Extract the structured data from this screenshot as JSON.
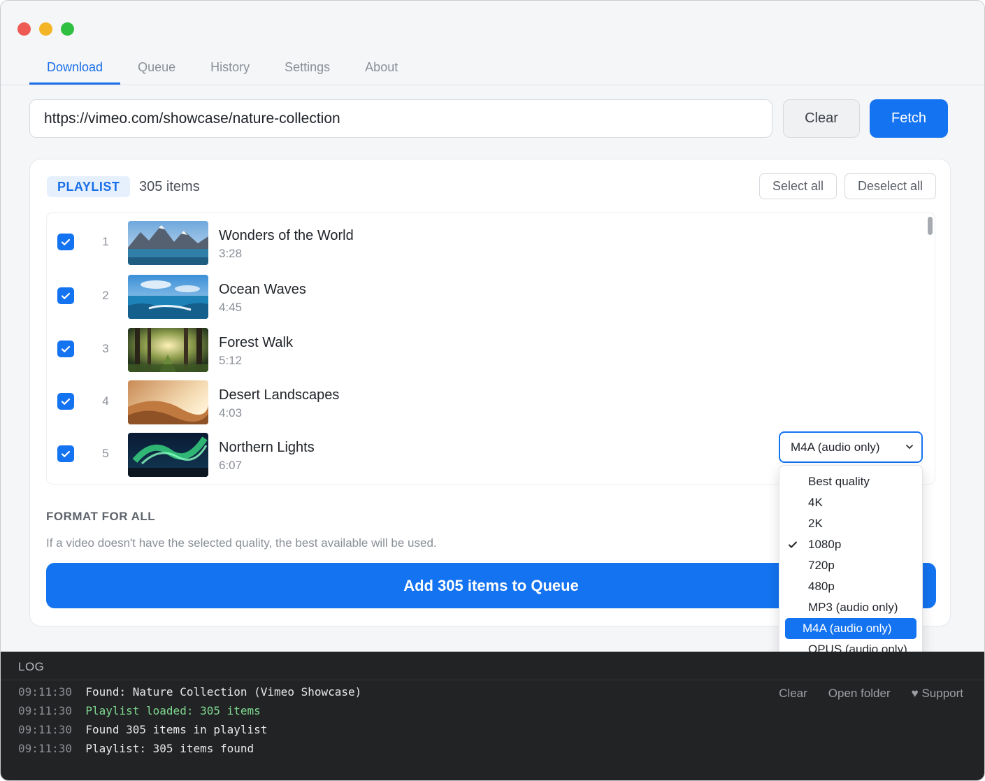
{
  "tabs": [
    "Download",
    "Queue",
    "History",
    "Settings",
    "About"
  ],
  "url": {
    "value": "https://vimeo.com/showcase/nature-collection",
    "clear_label": "Clear",
    "fetch_label": "Fetch"
  },
  "playlist": {
    "badge": "PLAYLIST",
    "count": "305 items",
    "select_all": "Select all",
    "deselect_all": "Deselect all",
    "items": [
      {
        "index": "1",
        "title": "Wonders of the World",
        "duration": "3:28",
        "checked": true,
        "thumb": "mountain-lake"
      },
      {
        "index": "2",
        "title": "Ocean Waves",
        "duration": "4:45",
        "checked": true,
        "thumb": "ocean"
      },
      {
        "index": "3",
        "title": "Forest Walk",
        "duration": "5:12",
        "checked": true,
        "thumb": "forest"
      },
      {
        "index": "4",
        "title": "Desert Landscapes",
        "duration": "4:03",
        "checked": true,
        "thumb": "desert"
      },
      {
        "index": "5",
        "title": "Northern Lights",
        "duration": "6:07",
        "checked": true,
        "thumb": "aurora"
      }
    ]
  },
  "format": {
    "label": "FORMAT FOR ALL",
    "hint": "If a video doesn't have the selected quality, the best available will be used.",
    "selected": "M4A (audio only)",
    "options": [
      "Best quality",
      "4K",
      "2K",
      "1080p",
      "720p",
      "480p",
      "MP3 (audio only)",
      "M4A (audio only)",
      "OPUS (audio only)"
    ],
    "checked_option": "1080p",
    "highlighted_option": "M4A (audio only)"
  },
  "add_button": "Add 305 items to Queue",
  "log": {
    "title": "LOG",
    "lines": [
      {
        "time": "09:11:30",
        "text": "Found: Nature Collection (Vimeo Showcase)",
        "color": "#e8e9eb"
      },
      {
        "time": "09:11:30",
        "text": "Playlist loaded: 305 items",
        "color": "#7fd98f"
      },
      {
        "time": "09:11:30",
        "text": "Found 305 items in playlist",
        "color": "#e8e9eb"
      },
      {
        "time": "09:11:30",
        "text": "Playlist: 305 items found",
        "color": "#e8e9eb"
      }
    ],
    "actions": {
      "clear": "Clear",
      "open_folder": "Open folder",
      "support": "Support"
    }
  },
  "colors": {
    "accent": "#1473f0",
    "log_bg": "#222325",
    "success": "#7fd98f",
    "support": "#ef6a8a"
  }
}
